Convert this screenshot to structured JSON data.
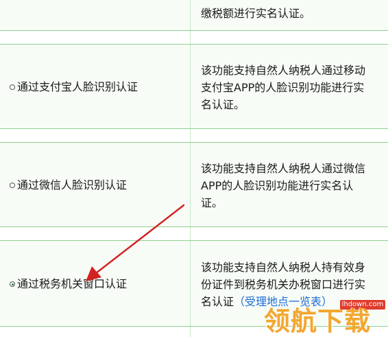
{
  "rows": [
    {
      "description_lines": [
        "缴税额进行实名认证。"
      ]
    },
    {
      "label": "通过支付宝人脸识别认证",
      "selected": false,
      "description_lines": [
        "该功能支持自然人纳税人通过移动",
        "支付宝APP的人脸识别功能进行实",
        "名认证。"
      ]
    },
    {
      "label": "通过微信人脸识别认证",
      "selected": false,
      "description_lines": [
        "该功能支持自然人纳税人通过微信",
        "APP的人脸识别功能进行实名认",
        "证。"
      ]
    },
    {
      "label": "通过税务机关窗口认证",
      "selected": true,
      "description_lines": [
        "该功能支持自然人纳税人持有效身",
        "份证件到税务机关办税窗口进行实"
      ],
      "description_last_prefix": "名认证",
      "link_text": "（受理地点一览表）"
    }
  ],
  "colors": {
    "border": "#8fcf8f",
    "link": "#1e6bd6",
    "arrow": "#d32222",
    "watermark": "#f2a01f"
  },
  "watermark": {
    "small": "lhdown.com",
    "big": "领航下载"
  }
}
